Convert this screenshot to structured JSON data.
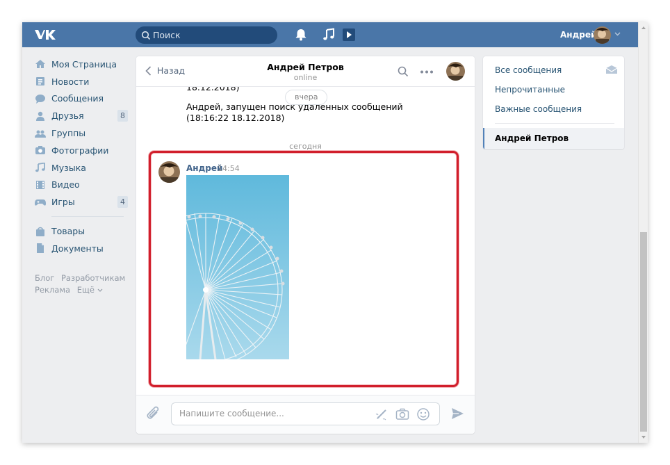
{
  "header": {
    "logo": "VK",
    "search_placeholder": "Поиск",
    "user_name": "Андрей",
    "icons": [
      "bell-icon",
      "music-note-icon",
      "video-play-icon"
    ]
  },
  "sidebar": {
    "items": [
      {
        "label": "Моя Страница",
        "icon": "home-icon"
      },
      {
        "label": "Новости",
        "icon": "news-icon"
      },
      {
        "label": "Сообщения",
        "icon": "chat-bubble-icon"
      },
      {
        "label": "Друзья",
        "icon": "person-icon",
        "badge": "8"
      },
      {
        "label": "Группы",
        "icon": "people-icon"
      },
      {
        "label": "Фотографии",
        "icon": "camera-icon"
      },
      {
        "label": "Музыка",
        "icon": "music-note-icon"
      },
      {
        "label": "Видео",
        "icon": "film-icon"
      },
      {
        "label": "Игры",
        "icon": "gamepad-icon",
        "badge": "4"
      },
      {
        "label": "Товары",
        "icon": "bag-icon"
      },
      {
        "label": "Документы",
        "icon": "document-icon"
      }
    ],
    "footer": {
      "blog": "Блог",
      "developers": "Разработчикам",
      "ads": "Реклама",
      "more": "Ещё"
    }
  },
  "chat": {
    "back_label": "Назад",
    "peer_name": "Андрей Петров",
    "peer_status": "online",
    "history": {
      "partial_time": "18.12.2018)",
      "date_separator_1": "вчера",
      "system_message": "Андрей, запущен поиск удаленных сообщений (18:16:22 18.12.2018)",
      "date_separator_2": "сегодня"
    },
    "message": {
      "author": "Андрей",
      "time": "14:54",
      "attachment": "ferris-wheel-photo"
    },
    "composer_placeholder": "Напишите сообщение..."
  },
  "right_menu": {
    "items": [
      "Все сообщения",
      "Непрочитанные",
      "Важные сообщения"
    ],
    "active": "Андрей Петров"
  },
  "colors": {
    "header": "#4a76a8",
    "link": "#285473",
    "highlight_frame": "#d11e2b"
  }
}
